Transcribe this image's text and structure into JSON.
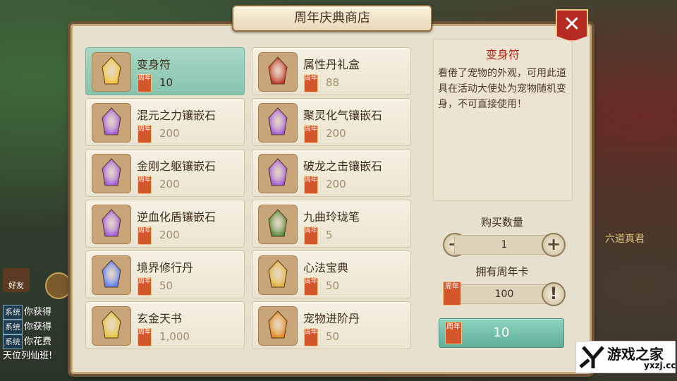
{
  "title": "周年庆典商店",
  "close_label": "✕",
  "items": [
    {
      "name": "变身符",
      "price": "10",
      "selected": true,
      "icon": "transform-talisman-icon",
      "color": "#f2c33a"
    },
    {
      "name": "属性丹礼盒",
      "price": "88",
      "selected": false,
      "icon": "pill-giftbox-icon",
      "color": "#c0392b"
    },
    {
      "name": "混元之力镶嵌石",
      "price": "200",
      "selected": false,
      "icon": "crystal-gem-icon",
      "color": "#a05ad6"
    },
    {
      "name": "聚灵化气镶嵌石",
      "price": "200",
      "selected": false,
      "icon": "crystal-gem-icon",
      "color": "#a05ad6"
    },
    {
      "name": "金刚之躯镶嵌石",
      "price": "200",
      "selected": false,
      "icon": "crystal-gem-icon",
      "color": "#a05ad6"
    },
    {
      "name": "破龙之击镶嵌石",
      "price": "200",
      "selected": false,
      "icon": "crystal-gem-icon",
      "color": "#a05ad6"
    },
    {
      "name": "逆血化盾镶嵌石",
      "price": "200",
      "selected": false,
      "icon": "crystal-gem-icon",
      "color": "#a05ad6"
    },
    {
      "name": "九曲玲珑笔",
      "price": "5",
      "selected": false,
      "icon": "brush-pen-icon",
      "color": "#5a8a3a"
    },
    {
      "name": "境界修行丹",
      "price": "50",
      "selected": false,
      "icon": "blue-orb-icon",
      "color": "#5f7cf0"
    },
    {
      "name": "心法宝典",
      "price": "50",
      "selected": false,
      "icon": "scroll-book-icon",
      "color": "#e0b23a"
    },
    {
      "name": "玄金天书",
      "price": "1,000",
      "selected": false,
      "icon": "golden-book-icon",
      "color": "#e6c33e"
    },
    {
      "name": "宠物进阶丹",
      "price": "50",
      "selected": false,
      "icon": "golden-pill-icon",
      "color": "#e08a1e"
    }
  ],
  "card_label": "周年",
  "detail": {
    "title": "变身符",
    "description": "看倦了宠物的外观，可用此道具在活动大使处为宠物随机变身，不可直接使用！"
  },
  "quantity": {
    "label": "购买数量",
    "value": "1",
    "minus": "−",
    "plus": "+"
  },
  "owned": {
    "label": "拥有周年卡",
    "value": "100",
    "info": "!"
  },
  "buy": {
    "price": "10"
  },
  "chat": [
    {
      "tag": "系统",
      "text": "你获得"
    },
    {
      "tag": "系统",
      "text": "你获得"
    },
    {
      "tag": "系统",
      "text": "你花费"
    },
    {
      "tag": "",
      "text": "天位列仙班!"
    }
  ],
  "side_caption": "六道真君",
  "friend_label": "好友",
  "logo": {
    "text": "游戏之家",
    "url": "yxzj.cc",
    "mark": "Y"
  }
}
